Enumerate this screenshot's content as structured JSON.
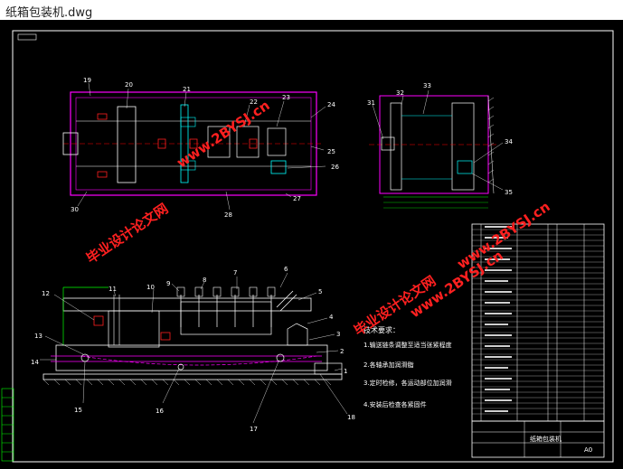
{
  "window": {
    "title": "纸箱包装机.dwg"
  },
  "drawing": {
    "top_view_labels": [
      "19",
      "20",
      "21",
      "22",
      "23",
      "24",
      "25",
      "26",
      "27",
      "28",
      "30"
    ],
    "side_view_labels": [
      "31",
      "32",
      "33",
      "34",
      "35"
    ],
    "front_view_labels": [
      "1",
      "2",
      "3",
      "4",
      "5",
      "6",
      "7",
      "8",
      "9",
      "10",
      "11",
      "12",
      "13",
      "14",
      "15",
      "16",
      "17",
      "18"
    ],
    "watermarks": [
      "www.2BYSJ.cn",
      "毕业设计论文网",
      "www.2BYSJ.cn",
      "毕业设计论文网",
      "www.2BYSJ.cn",
      "毕业设计论文网"
    ],
    "notes_title": "技术要求：",
    "notes": [
      "1.输送链条调整至适当张紧程度",
      "2.各轴承加润滑脂",
      "3.定时检修，各运动部位加润滑",
      "4.安装后检查各紧固件"
    ],
    "title_block": {
      "drawing_name": "纸箱包装机",
      "scale": "A0"
    }
  },
  "colors": {
    "frame": "#ffffff",
    "outline": "#ff00ff",
    "part": "#00ffff",
    "center": "#ff0000",
    "green": "#00ff00",
    "yellow": "#ffff00",
    "watermark": "#ff2020"
  }
}
